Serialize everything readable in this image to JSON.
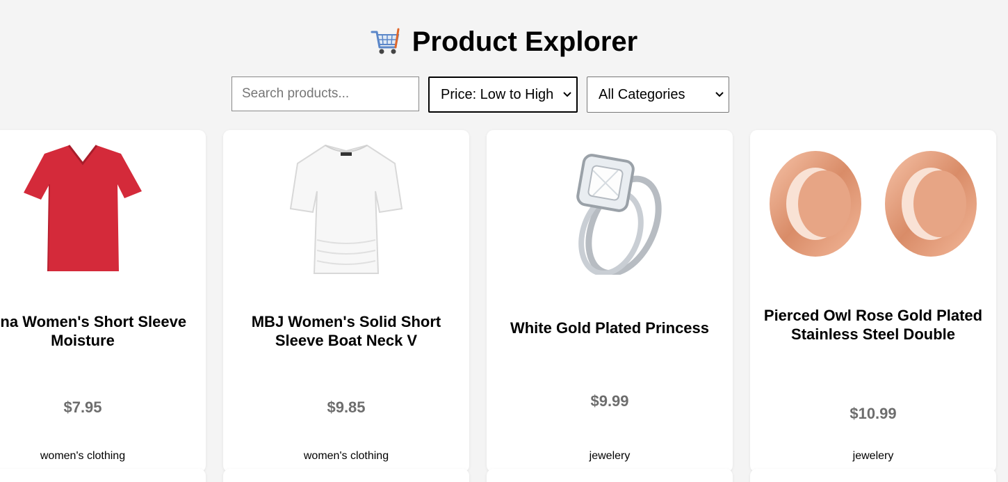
{
  "header": {
    "title": "Product Explorer"
  },
  "search": {
    "placeholder": "Search products..."
  },
  "sort": {
    "selected": "Price: Low to High"
  },
  "category_filter": {
    "selected": "All Categories"
  },
  "products": [
    {
      "name": "Opna Women's Short Sleeve Moisture",
      "price": "$7.95",
      "category": "women's clothing"
    },
    {
      "name": "MBJ Women's Solid Short Sleeve Boat Neck V",
      "price": "$9.85",
      "category": "women's clothing"
    },
    {
      "name": "White Gold Plated Princess",
      "price": "$9.99",
      "category": "jewelery"
    },
    {
      "name": "Pierced Owl Rose Gold Plated Stainless Steel Double",
      "price": "$10.99",
      "category": "jewelery"
    }
  ]
}
